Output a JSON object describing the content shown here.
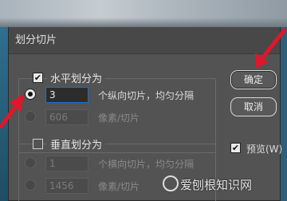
{
  "dialog": {
    "title": "划分切片",
    "horizontal": {
      "enabled": true,
      "label": "水平划分为",
      "count_value": "3",
      "count_suffix": "个纵向切片，均匀分隔",
      "pixels_value": "606",
      "pixels_suffix": "像素/切片"
    },
    "vertical": {
      "enabled": false,
      "label": "垂直划分为",
      "count_value": "1",
      "count_suffix": "个横向切片，均匀分隔",
      "pixels_value": "1456",
      "pixels_suffix": "像素/切片"
    },
    "buttons": {
      "ok": "确定",
      "cancel": "取消"
    },
    "preview": {
      "checked": true,
      "label": "预览(W)"
    }
  },
  "watermark": "爱刨根知识网",
  "colors": {
    "annotation_arrow": "#e0162b",
    "dialog_bg": "#535353",
    "focus_border": "#1d6fc9"
  }
}
